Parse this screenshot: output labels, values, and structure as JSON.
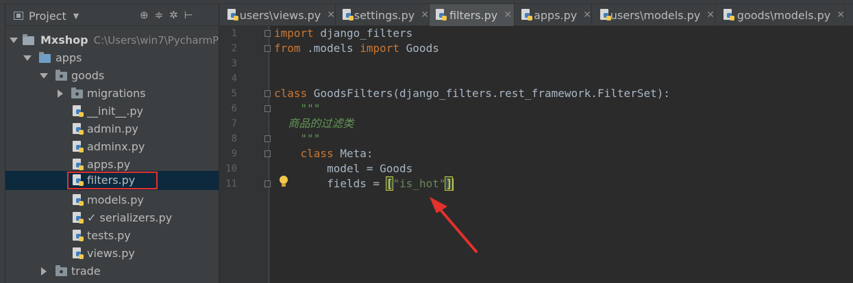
{
  "project_panel": {
    "title": "Project",
    "tree": [
      {
        "label": "Mxshop",
        "hint": "C:\\Users\\win7\\PycharmP",
        "kind": "project"
      },
      {
        "label": "apps",
        "kind": "folder"
      },
      {
        "label": "goods",
        "kind": "package"
      },
      {
        "label": "migrations",
        "kind": "package"
      },
      {
        "label": "__init__.py",
        "kind": "py"
      },
      {
        "label": "admin.py",
        "kind": "py"
      },
      {
        "label": "adminx.py",
        "kind": "py"
      },
      {
        "label": "apps.py",
        "kind": "py"
      },
      {
        "label": "filters.py",
        "kind": "py",
        "selected": true
      },
      {
        "label": "models.py",
        "kind": "py"
      },
      {
        "label": "✓ serializers.py",
        "kind": "py"
      },
      {
        "label": "tests.py",
        "kind": "py"
      },
      {
        "label": "views.py",
        "kind": "py"
      },
      {
        "label": "trade",
        "kind": "package"
      }
    ]
  },
  "tabs": [
    {
      "label": "users\\views.py"
    },
    {
      "label": "settings.py"
    },
    {
      "label": "filters.py",
      "active": true
    },
    {
      "label": "apps.py"
    },
    {
      "label": "users\\models.py"
    },
    {
      "label": "goods\\models.py"
    }
  ],
  "editor": {
    "line_numbers": [
      "1",
      "2",
      "3",
      "4",
      "5",
      "6",
      "7",
      "8",
      "9",
      "10",
      "11"
    ],
    "code": {
      "l1_kw": "import",
      "l1_rest": " django_filters",
      "l2_kw1": "from",
      "l2_mid": " .models ",
      "l2_kw2": "import",
      "l2_rest": " Goods",
      "l5_kw": "class",
      "l5_rest": " GoodsFilters(django_filters.rest_framework.FilterSet):",
      "l6_doc": "    \"\"\"",
      "l7_doc": "    商品的过滤类",
      "l8_doc": "    \"\"\"",
      "l9_indent": "    ",
      "l9_kw": "class",
      "l9_rest": " Meta:",
      "l10": "        model = Goods",
      "l11_pre": "        fields = ",
      "l11_open": "[",
      "l11_str": "\"is_hot\"",
      "l11_close": "]"
    }
  },
  "colors": {
    "background": "#2b2b2b",
    "panel": "#3c3f41",
    "keyword": "#cc7832",
    "docstring": "#629755",
    "string": "#6a8759",
    "annotation": "#e5312b"
  }
}
